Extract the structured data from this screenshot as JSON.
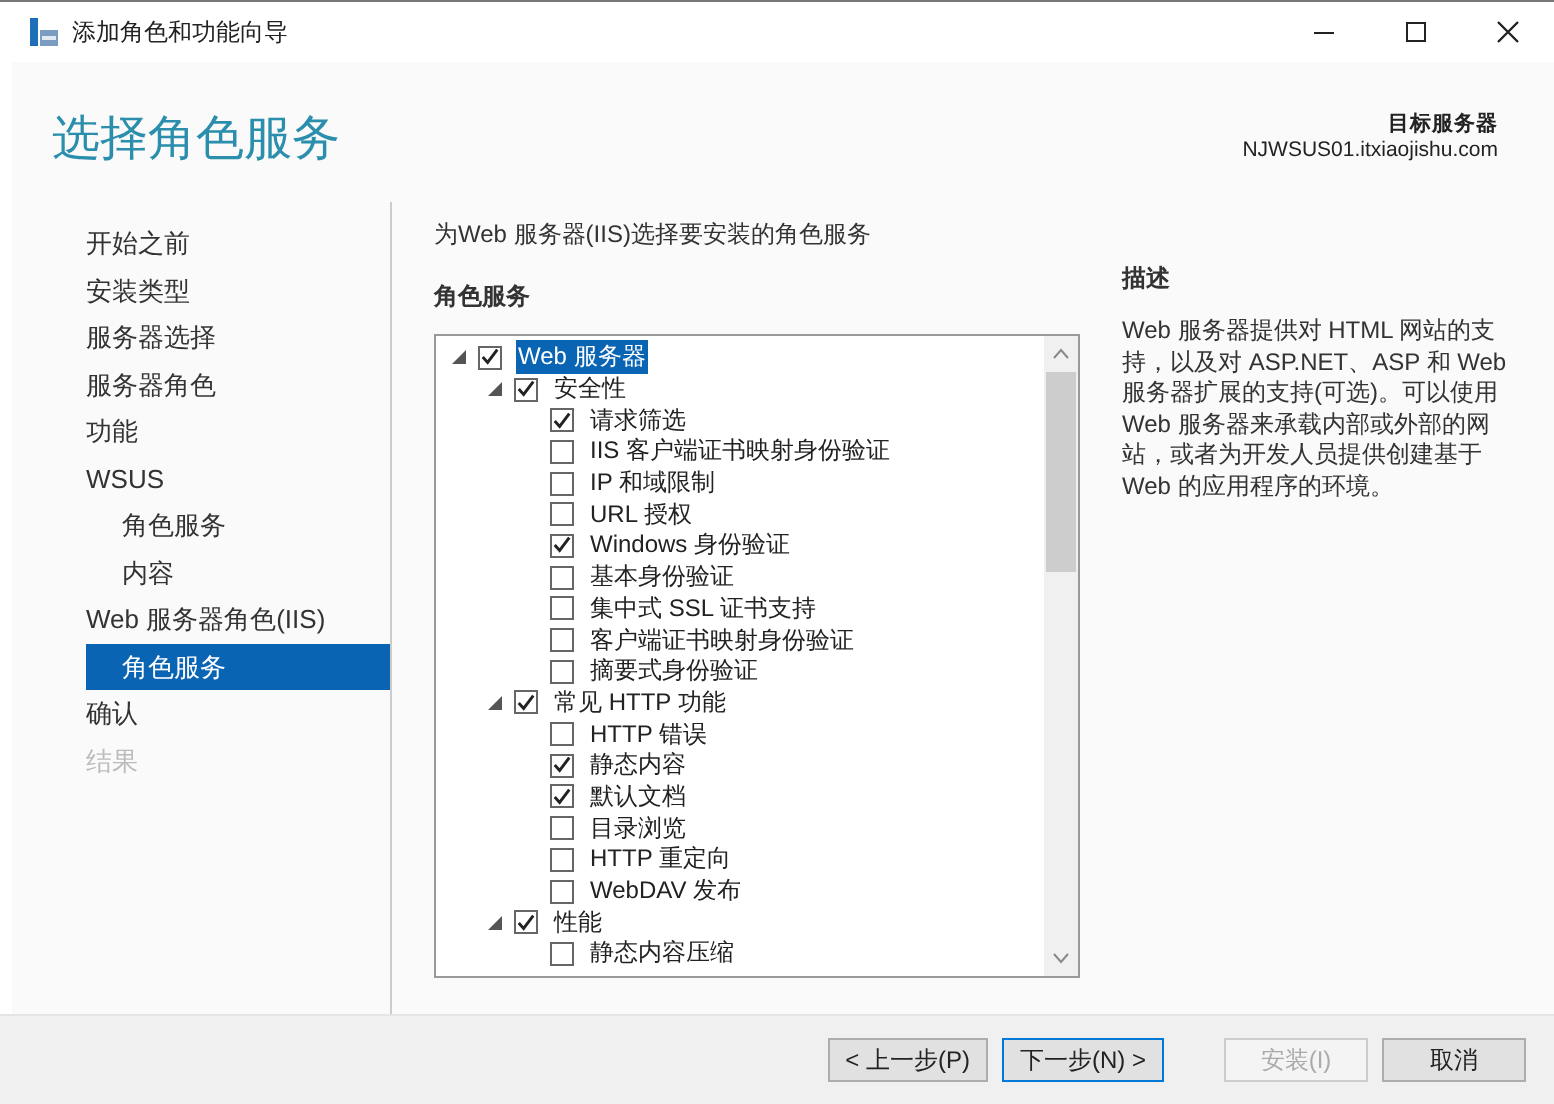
{
  "window": {
    "title": "添加角色和功能向导"
  },
  "header": {
    "title": "选择角色服务",
    "target_label": "目标服务器",
    "target_server": "NJWSUS01.itxiaojishu.com"
  },
  "sidebar": {
    "items": [
      {
        "label": "开始之前",
        "selected": false,
        "disabled": false
      },
      {
        "label": "安装类型",
        "selected": false,
        "disabled": false
      },
      {
        "label": "服务器选择",
        "selected": false,
        "disabled": false
      },
      {
        "label": "服务器角色",
        "selected": false,
        "disabled": false
      },
      {
        "label": "功能",
        "selected": false,
        "disabled": false
      },
      {
        "label": "WSUS",
        "selected": false,
        "disabled": false,
        "children": [
          {
            "label": "角色服务",
            "selected": false,
            "disabled": false
          },
          {
            "label": "内容",
            "selected": false,
            "disabled": false
          }
        ]
      },
      {
        "label": "Web 服务器角色(IIS)",
        "selected": false,
        "disabled": false,
        "children": [
          {
            "label": "角色服务",
            "selected": true,
            "disabled": false
          }
        ]
      },
      {
        "label": "确认",
        "selected": false,
        "disabled": false
      },
      {
        "label": "结果",
        "selected": false,
        "disabled": true
      }
    ]
  },
  "content": {
    "instruction": "为Web 服务器(IIS)选择要安装的角色服务",
    "tree_heading": "角色服务",
    "tree": [
      {
        "label": "Web 服务器",
        "checked": true,
        "expanded": true,
        "selected": true,
        "children": [
          {
            "label": "安全性",
            "checked": true,
            "expanded": true,
            "selected": false,
            "children": [
              {
                "label": "请求筛选",
                "checked": true,
                "selected": false
              },
              {
                "label": "IIS 客户端证书映射身份验证",
                "checked": false,
                "selected": false
              },
              {
                "label": "IP 和域限制",
                "checked": false,
                "selected": false
              },
              {
                "label": "URL 授权",
                "checked": false,
                "selected": false
              },
              {
                "label": "Windows 身份验证",
                "checked": true,
                "selected": false
              },
              {
                "label": "基本身份验证",
                "checked": false,
                "selected": false
              },
              {
                "label": "集中式 SSL 证书支持",
                "checked": false,
                "selected": false
              },
              {
                "label": "客户端证书映射身份验证",
                "checked": false,
                "selected": false
              },
              {
                "label": "摘要式身份验证",
                "checked": false,
                "selected": false
              }
            ]
          },
          {
            "label": "常见 HTTP 功能",
            "checked": true,
            "expanded": true,
            "selected": false,
            "children": [
              {
                "label": "HTTP 错误",
                "checked": false,
                "selected": false
              },
              {
                "label": "静态内容",
                "checked": true,
                "selected": false
              },
              {
                "label": "默认文档",
                "checked": true,
                "selected": false
              },
              {
                "label": "目录浏览",
                "checked": false,
                "selected": false
              },
              {
                "label": "HTTP 重定向",
                "checked": false,
                "selected": false
              },
              {
                "label": "WebDAV 发布",
                "checked": false,
                "selected": false
              }
            ]
          },
          {
            "label": "性能",
            "checked": true,
            "expanded": true,
            "selected": false,
            "children": [
              {
                "label": "静态内容压缩",
                "checked": false,
                "selected": false
              }
            ]
          }
        ]
      }
    ],
    "description_heading": "描述",
    "description": "Web 服务器提供对 HTML 网站的支持，以及对 ASP.NET、ASP 和 Web 服务器扩展的支持(可选)。可以使用 Web 服务器来承载内部或外部的网站，或者为开发人员提供创建基于 Web 的应用程序的环境。"
  },
  "buttons": [
    {
      "label": "< 上一步(P)",
      "disabled": false,
      "selected": false
    },
    {
      "label": "下一步(N) >",
      "disabled": false,
      "selected": true
    },
    {
      "label": "安装(I)",
      "disabled": true,
      "selected": false
    },
    {
      "label": "取消",
      "disabled": false,
      "selected": false
    }
  ]
}
